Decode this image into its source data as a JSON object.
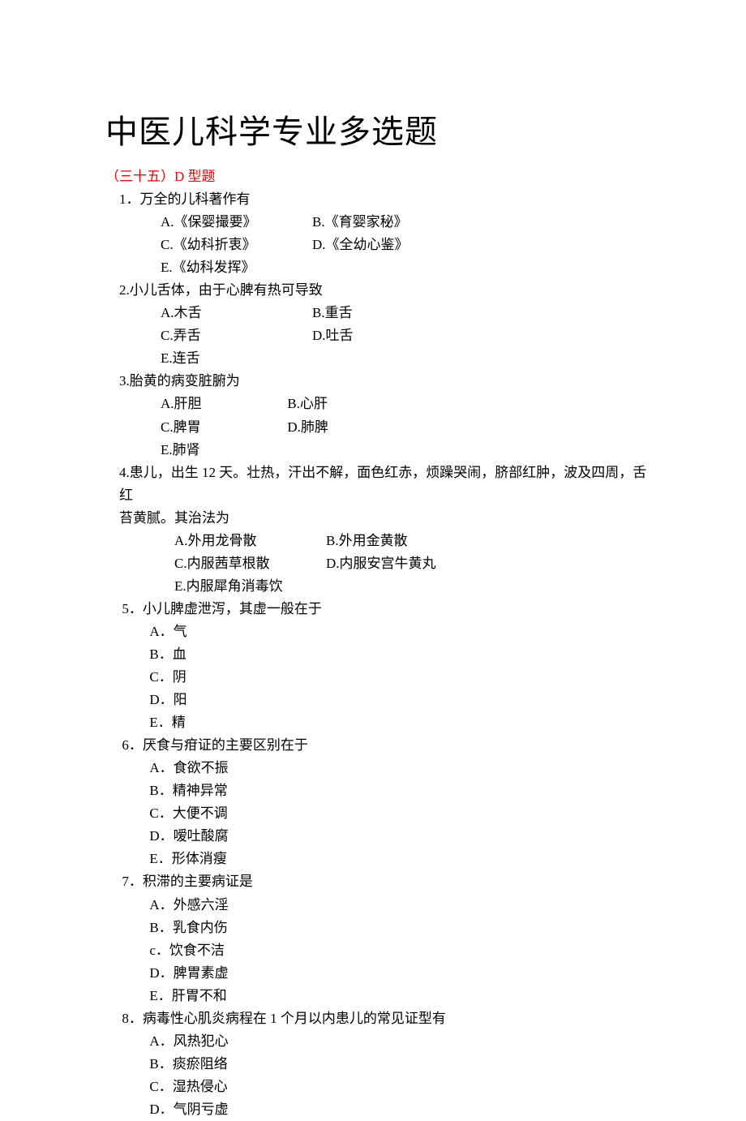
{
  "title": "中医儿科学专业多选题",
  "section_header": "（三十五）D 型题",
  "questions": [
    {
      "num": "1．",
      "stem": "万全的儿科著作有",
      "option_rows": [
        [
          "A.《保婴撮要》",
          "B.《育婴家秘》"
        ],
        [
          "C.《幼科折衷》",
          "D.《全幼心鉴》"
        ],
        [
          "E.《幼科发挥》"
        ]
      ]
    },
    {
      "num": "2.",
      "stem": "小儿舌体，由于心脾有热可导致",
      "option_rows": [
        [
          "A.木舌",
          "B.重舌"
        ],
        [
          "C.弄舌",
          "D.吐舌"
        ],
        [
          "E.连舌"
        ]
      ]
    },
    {
      "num": "3.",
      "stem": "胎黄的病变脏腑为",
      "option_rows": [
        [
          "A.肝胆",
          "B.心肝"
        ],
        [
          "C.脾胃",
          "D.肺脾"
        ],
        [
          "E.肺肾"
        ]
      ],
      "col_a_width": "9.2em"
    },
    {
      "num": "4.",
      "stem": "患儿，出生 12 天。壮热，汗出不解，面色红赤，烦躁哭闹，脐部红肿，波及四周，舌红",
      "stem2": "苔黄腻。其治法为",
      "wide": true,
      "option_rows": [
        [
          "A.外用龙骨散",
          "B.外用金黄散"
        ],
        [
          "C.内服茜草根散",
          "D.内服安宫牛黄丸"
        ],
        [
          "E.内服犀角消毒饮"
        ]
      ],
      "opt_indent": "5em"
    },
    {
      "num": "5．",
      "stem": "小儿脾虚泄泻，其虚一般在于",
      "options": [
        "A．气",
        "B．血",
        "C．阴",
        "D．阳",
        "E．精"
      ]
    },
    {
      "num": "6．",
      "stem": "厌食与疳证的主要区别在于",
      "options": [
        "A．食欲不振",
        "B．精神异常",
        "C．大便不调",
        "D．嗳吐酸腐",
        "E．形体消瘦"
      ]
    },
    {
      "num": "7．",
      "stem": "积滞的主要病证是",
      "options": [
        "A．外感六淫",
        "B．乳食内伤",
        "c．饮食不洁",
        "D．脾胃素虚",
        "E．肝胃不和"
      ]
    },
    {
      "num": "8．",
      "stem": "病毒性心肌炎病程在 1 个月以内患儿的常见证型有",
      "options": [
        "A．风热犯心",
        "B．痰瘀阻络",
        "C．湿热侵心",
        "D．气阴亏虚"
      ]
    }
  ]
}
